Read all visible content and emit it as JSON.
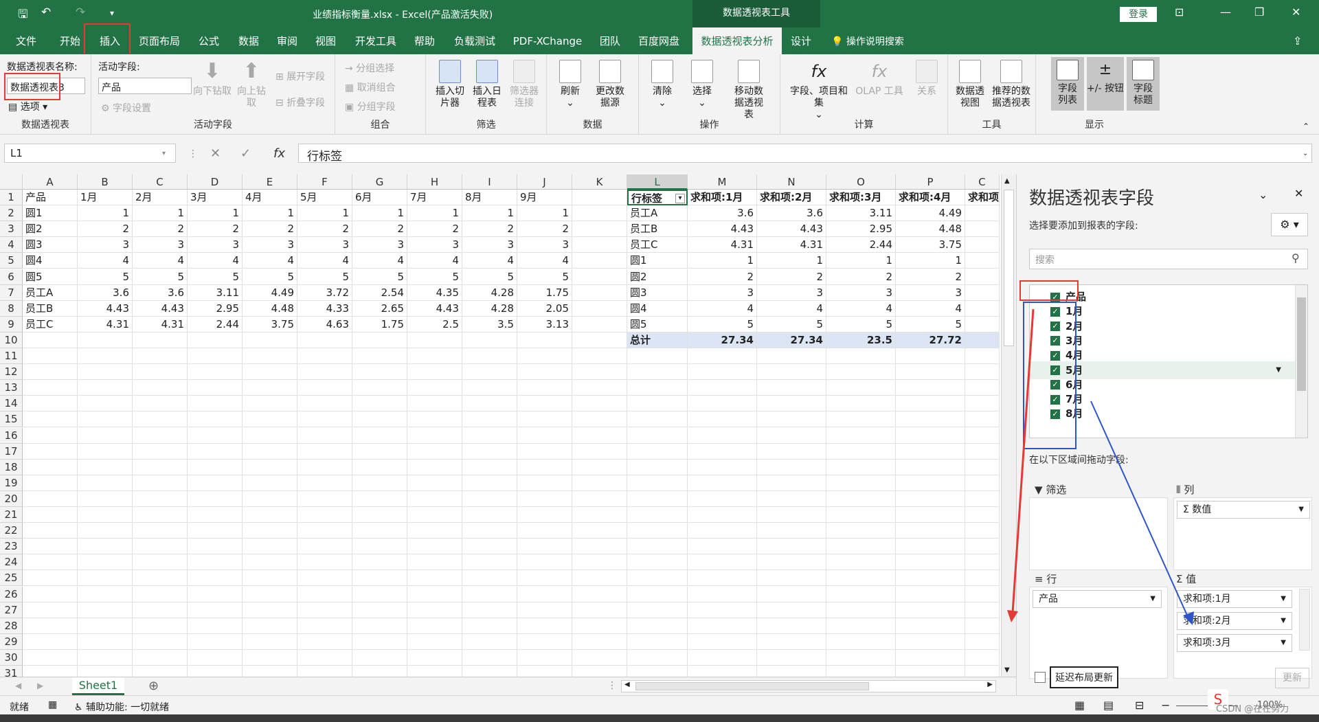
{
  "window": {
    "title": "业绩指标衡量.xlsx  -  Excel(产品激活失败)",
    "context_tools": "数据透视表工具",
    "login": "登录"
  },
  "tabs": [
    "文件",
    "开始",
    "插入",
    "页面布局",
    "公式",
    "数据",
    "审阅",
    "视图",
    "开发工具",
    "帮助",
    "负载测试",
    "PDF-XChange",
    "团队",
    "百度网盘",
    "数据透视表分析",
    "设计"
  ],
  "tell_me": "操作说明搜索",
  "ribbon": {
    "pt_name_label": "数据透视表名称:",
    "pt_name": "数据透视表3",
    "options": "选项",
    "group_pt": "数据透视表",
    "active_field_label": "活动字段:",
    "active_field": "产品",
    "field_settings": "字段设置",
    "drill_down": "向下钻取",
    "drill_up": "向上钻取",
    "expand": "展开字段",
    "collapse": "折叠字段",
    "group_active": "活动字段",
    "group_sel": "分组选择",
    "ungroup": "取消组合",
    "group_field": "分组字段",
    "group_group": "组合",
    "slicer": "插入切片器",
    "timeline": "插入日程表",
    "filter_conn": "筛选器连接",
    "group_filter": "筛选",
    "refresh": "刷新",
    "change_src": "更改数据源",
    "group_data": "数据",
    "clear": "清除",
    "select": "选择",
    "move": "移动数据透视表",
    "group_actions": "操作",
    "fields_items": "字段、项目和集",
    "olap": "OLAP 工具",
    "relations": "关系",
    "group_calc": "计算",
    "pivot_chart": "数据透视图",
    "recommended": "推荐的数据透视表",
    "group_tools": "工具",
    "field_list": "字段列表",
    "pm_buttons": "+/- 按钮",
    "field_headers": "字段标题",
    "group_show": "显示"
  },
  "formula_bar": {
    "name_box": "L1",
    "formula": "行标签"
  },
  "columns": [
    "A",
    "B",
    "C",
    "D",
    "E",
    "F",
    "G",
    "H",
    "I",
    "J",
    "K",
    "L",
    "M",
    "N",
    "O",
    "P",
    "C"
  ],
  "rows": [
    "1",
    "2",
    "3",
    "4",
    "5",
    "6",
    "7",
    "8",
    "9",
    "10",
    "11",
    "12",
    "13",
    "14",
    "15",
    "16",
    "17",
    "18",
    "19",
    "20",
    "21",
    "22",
    "23",
    "24",
    "25",
    "26",
    "27",
    "28",
    "29",
    "30",
    "31"
  ],
  "source_table": {
    "header": [
      "产品",
      "1月",
      "2月",
      "3月",
      "4月",
      "5月",
      "6月",
      "7月",
      "8月",
      "9月"
    ],
    "rows": [
      [
        "圆1",
        "1",
        "1",
        "1",
        "1",
        "1",
        "1",
        "1",
        "1",
        "1"
      ],
      [
        "圆2",
        "2",
        "2",
        "2",
        "2",
        "2",
        "2",
        "2",
        "2",
        "2"
      ],
      [
        "圆3",
        "3",
        "3",
        "3",
        "3",
        "3",
        "3",
        "3",
        "3",
        "3"
      ],
      [
        "圆4",
        "4",
        "4",
        "4",
        "4",
        "4",
        "4",
        "4",
        "4",
        "4"
      ],
      [
        "圆5",
        "5",
        "5",
        "5",
        "5",
        "5",
        "5",
        "5",
        "5",
        "5"
      ],
      [
        "员工A",
        "3.6",
        "3.6",
        "3.11",
        "4.49",
        "3.72",
        "2.54",
        "4.35",
        "4.28",
        "1.75"
      ],
      [
        "员工B",
        "4.43",
        "4.43",
        "2.95",
        "4.48",
        "4.33",
        "2.65",
        "4.43",
        "4.28",
        "2.05"
      ],
      [
        "员工C",
        "4.31",
        "4.31",
        "2.44",
        "3.75",
        "4.63",
        "1.75",
        "2.5",
        "3.5",
        "3.13"
      ]
    ]
  },
  "pivot": {
    "header": [
      "行标签",
      "求和项:1月",
      "求和项:2月",
      "求和项:3月",
      "求和项:4月",
      "求和项"
    ],
    "rows": [
      [
        "员工A",
        "3.6",
        "3.6",
        "3.11",
        "4.49"
      ],
      [
        "员工B",
        "4.43",
        "4.43",
        "2.95",
        "4.48"
      ],
      [
        "员工C",
        "4.31",
        "4.31",
        "2.44",
        "3.75"
      ],
      [
        "圆1",
        "1",
        "1",
        "1",
        "1"
      ],
      [
        "圆2",
        "2",
        "2",
        "2",
        "2"
      ],
      [
        "圆3",
        "3",
        "3",
        "3",
        "3"
      ],
      [
        "圆4",
        "4",
        "4",
        "4",
        "4"
      ],
      [
        "圆5",
        "5",
        "5",
        "5",
        "5"
      ]
    ],
    "total": [
      "总计",
      "27.34",
      "27.34",
      "23.5",
      "27.72"
    ]
  },
  "sheet_tab": "Sheet1",
  "status": {
    "ready": "就绪",
    "accessibility": "辅助功能: 一切就绪",
    "zoom": "100%",
    "watermark": "CSDN @在在努力"
  },
  "panel": {
    "title": "数据透视表字段",
    "subtitle": "选择要添加到报表的字段:",
    "search_placeholder": "搜索",
    "fields": [
      "产品",
      "1月",
      "2月",
      "3月",
      "4月",
      "5月",
      "6月",
      "7月",
      "8月"
    ],
    "drag_label": "在以下区域间拖动字段:",
    "filter_area": "筛选",
    "col_area": "列",
    "row_area": "行",
    "val_area": "值",
    "col_item": "数值",
    "row_item": "产品",
    "val_items": [
      "求和项:1月",
      "求和项:2月",
      "求和项:3月"
    ],
    "defer": "延迟布局更新",
    "update": "更新"
  },
  "colors": {
    "excel_green": "#217346",
    "annotation_red": "#e53935",
    "annotation_blue": "#2d55c8"
  }
}
